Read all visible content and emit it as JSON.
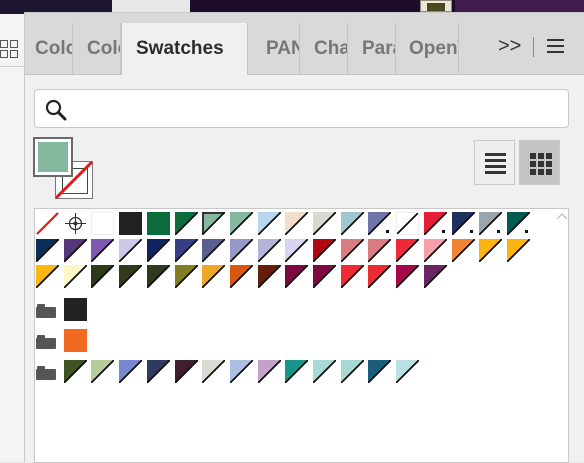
{
  "tabs": [
    {
      "label": "Color"
    },
    {
      "label": "Color Guide"
    },
    {
      "label": "Swatches"
    },
    {
      "label": "PANTONE"
    },
    {
      "label": "Character"
    },
    {
      "label": "Paragraph"
    },
    {
      "label": "OpenType"
    }
  ],
  "active_tab": "Swatches",
  "tab_overflow_label": ">>",
  "search": {
    "placeholder": "",
    "value": ""
  },
  "fill_color": "#86b8a0",
  "stroke": "none",
  "view_mode": "large-thumbnail",
  "icons": [
    "search-icon",
    "list-view-icon",
    "grid-view-icon",
    "panel-menu-icon",
    "folder-icon",
    "registration-icon",
    "none-swatch-icon"
  ],
  "swatch_rows": [
    [
      {
        "kind": "none"
      },
      {
        "kind": "registration"
      },
      {
        "kind": "solid",
        "color": "#ffffff"
      },
      {
        "kind": "solid",
        "color": "#212121"
      },
      {
        "kind": "solid",
        "color": "#0c6b3b"
      },
      {
        "kind": "diag",
        "color": "#0c6b3b"
      },
      {
        "kind": "diag",
        "color": "#86b8a0",
        "selected": true
      },
      {
        "kind": "diag",
        "color": "#86b8a0"
      },
      {
        "kind": "diag",
        "color": "#b9d6ef"
      },
      {
        "kind": "diag",
        "color": "#f2dcca"
      },
      {
        "kind": "diag",
        "color": "#dad8d2"
      },
      {
        "kind": "diag",
        "color": "#9ec8cd"
      },
      {
        "kind": "diag",
        "color": "#6e75a8",
        "spot": true
      },
      {
        "kind": "diag",
        "color": "#ffffff"
      },
      {
        "kind": "diag",
        "color": "#e51c3a",
        "spot": true
      },
      {
        "kind": "diag",
        "color": "#1d3160",
        "spot": true
      },
      {
        "kind": "diag",
        "color": "#9aa6ad",
        "spot": true
      },
      {
        "kind": "diag",
        "color": "#005b52",
        "spot": true
      }
    ],
    [
      {
        "kind": "diag",
        "color": "#0c2d55"
      },
      {
        "kind": "diag",
        "color": "#53377a"
      },
      {
        "kind": "diag",
        "color": "#7b5ab0"
      },
      {
        "kind": "diag",
        "color": "#cdc8e8"
      },
      {
        "kind": "diag",
        "color": "#0f245e"
      },
      {
        "kind": "diag",
        "color": "#343f86"
      },
      {
        "kind": "diag",
        "color": "#596091"
      },
      {
        "kind": "diag",
        "color": "#9797cc"
      },
      {
        "kind": "diag",
        "color": "#b4b4d8"
      },
      {
        "kind": "diag",
        "color": "#d6d4ee"
      },
      {
        "kind": "diag",
        "color": "#b00712"
      },
      {
        "kind": "diag",
        "color": "#d77d81"
      },
      {
        "kind": "diag",
        "color": "#dc7a82"
      },
      {
        "kind": "diag",
        "color": "#f0283a"
      },
      {
        "kind": "diag",
        "color": "#f8a0a8"
      },
      {
        "kind": "diag",
        "color": "#f28533"
      },
      {
        "kind": "diag",
        "color": "#fbb40f"
      },
      {
        "kind": "diag",
        "color": "#fbb40f"
      }
    ],
    [
      {
        "kind": "diag",
        "color": "#fdb50f"
      },
      {
        "kind": "diag",
        "color": "#fdf7c8"
      },
      {
        "kind": "diag",
        "color": "#2c3a1a"
      },
      {
        "kind": "diag",
        "color": "#313a1b"
      },
      {
        "kind": "diag",
        "color": "#2f3a1c"
      },
      {
        "kind": "diag",
        "color": "#827c27"
      },
      {
        "kind": "diag",
        "color": "#eca727"
      },
      {
        "kind": "diag",
        "color": "#d8560f"
      },
      {
        "kind": "diag",
        "color": "#661d09"
      },
      {
        "kind": "diag",
        "color": "#7a0a41"
      },
      {
        "kind": "diag",
        "color": "#7d0842"
      },
      {
        "kind": "diag",
        "color": "#ee2a35"
      },
      {
        "kind": "diag",
        "color": "#ed2932"
      },
      {
        "kind": "diag",
        "color": "#a8064c"
      },
      {
        "kind": "diag",
        "color": "#6a2562"
      }
    ]
  ],
  "groups": [
    [
      {
        "kind": "solid",
        "color": "#222222"
      }
    ],
    [
      {
        "kind": "solid",
        "color": "#f26922"
      }
    ],
    [
      {
        "kind": "diag",
        "color": "#3e5224"
      },
      {
        "kind": "diag",
        "color": "#b6cc98"
      },
      {
        "kind": "diag",
        "color": "#7889ce"
      },
      {
        "kind": "diag",
        "color": "#2e3a60"
      },
      {
        "kind": "diag",
        "color": "#421d2e"
      },
      {
        "kind": "diag",
        "color": "#d8dcd4"
      },
      {
        "kind": "diag",
        "color": "#aebde2"
      },
      {
        "kind": "diag",
        "color": "#c4a1cc"
      },
      {
        "kind": "diag",
        "color": "#18958b"
      },
      {
        "kind": "diag",
        "color": "#aadad8"
      },
      {
        "kind": "diag",
        "color": "#a6d9d6"
      },
      {
        "kind": "diag",
        "color": "#1b5e7a"
      },
      {
        "kind": "diag",
        "color": "#b9e0e2"
      }
    ]
  ]
}
